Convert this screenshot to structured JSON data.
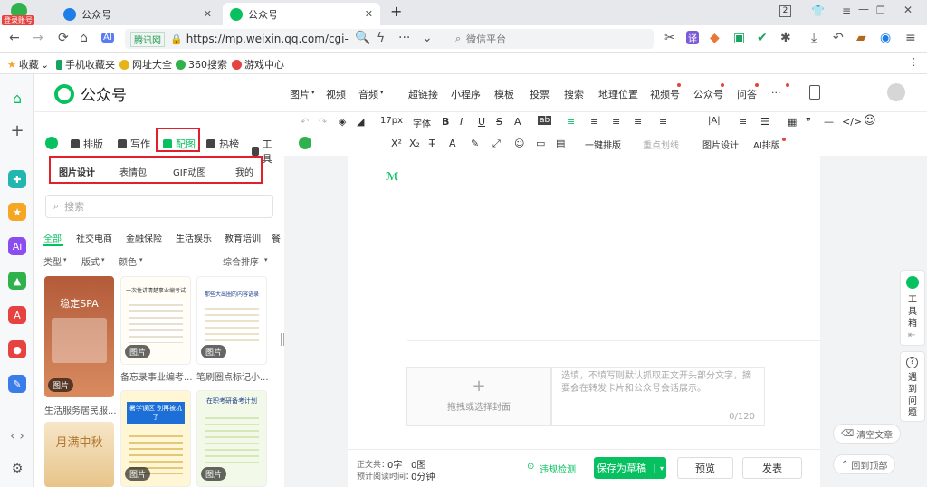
{
  "browser": {
    "login_badge": "登录账号",
    "tabs": [
      {
        "title": "公众号",
        "active": false
      },
      {
        "title": "公众号",
        "active": true
      }
    ],
    "new_tab": "+",
    "tab_count": "2",
    "url_site": "腾讯网",
    "url": "https://mp.weixin.qq.com/cgi-",
    "search_placeholder": "微信平台",
    "bookmarks": [
      "收藏",
      "手机收藏夹",
      "网址大全",
      "360搜索",
      "游戏中心"
    ]
  },
  "site": {
    "name": "公众号",
    "media_tools": [
      "图片",
      "视频",
      "音频",
      "超链接",
      "小程序",
      "模板",
      "投票",
      "搜索",
      "地理位置",
      "视频号",
      "公众号",
      "问答",
      "···"
    ]
  },
  "editor_toolbar": {
    "row1": [
      "↶",
      "↷",
      "17px",
      "字体",
      "B",
      "I",
      "U",
      "S",
      "A",
      "ab",
      "≡",
      "≡",
      "≡",
      "≡",
      "≡",
      "|A|",
      "≡",
      "☰",
      "▦",
      "❞",
      "—",
      "</>",
      "☺"
    ],
    "row2": [
      "X²",
      "X₂",
      "T̶",
      "A",
      "✎",
      "⤢",
      "☺",
      "▭",
      "▤",
      "一键排版",
      "重点划线",
      "图片设计",
      "AI排版"
    ]
  },
  "panel": {
    "tabs": [
      {
        "label": "排版"
      },
      {
        "label": "写作"
      },
      {
        "label": "配图"
      },
      {
        "label": "热榜"
      },
      {
        "label": "工具"
      }
    ],
    "subtabs": [
      "图片设计",
      "表情包",
      "GIF动图",
      "我的"
    ],
    "search_placeholder": "搜索",
    "categories": [
      "全部",
      "社交电商",
      "金融保险",
      "生活娱乐",
      "教育培训",
      "餐"
    ],
    "filters": [
      "类型",
      "版式",
      "颜色",
      "综合排序"
    ],
    "thumbnails": [
      {
        "caption": "生活服务居民服...",
        "badge": "图片",
        "text": "稳定SPA"
      },
      {
        "caption": "备忘录事业编考...",
        "badge": "图片",
        "text": "一次性讲清楚事业编考试"
      },
      {
        "caption": "笔刷圈点标记小...",
        "badge": "图片",
        "text": "那些大出圈的内容语录"
      },
      {
        "caption": "",
        "badge": "图片",
        "text": "月满中秋"
      },
      {
        "caption": "",
        "badge": "图片",
        "text": "暑学误区 别再被坑了"
      },
      {
        "caption": "",
        "badge": "图片",
        "text": "在职考研备考计划"
      }
    ]
  },
  "canvas": {
    "cover_hint": "拖拽或选择封面",
    "summary_placeholder": "选填，不填写则默认抓取正文开头部分文字，摘要会在转发卡片和公众号会话展示。",
    "summary_count": "0/120"
  },
  "bottom": {
    "word_count_label": "正文共：",
    "word_count": "0字",
    "image_count": "0图",
    "read_time_label": "预计阅读时间：",
    "read_time": "0分钟",
    "check": "违规检测",
    "save": "保存为草稿",
    "preview": "预览",
    "publish": "发表"
  },
  "float": {
    "toolbox": "工具箱",
    "help": "遇到问题",
    "clear": "清空文章",
    "back_top": "回到顶部"
  }
}
